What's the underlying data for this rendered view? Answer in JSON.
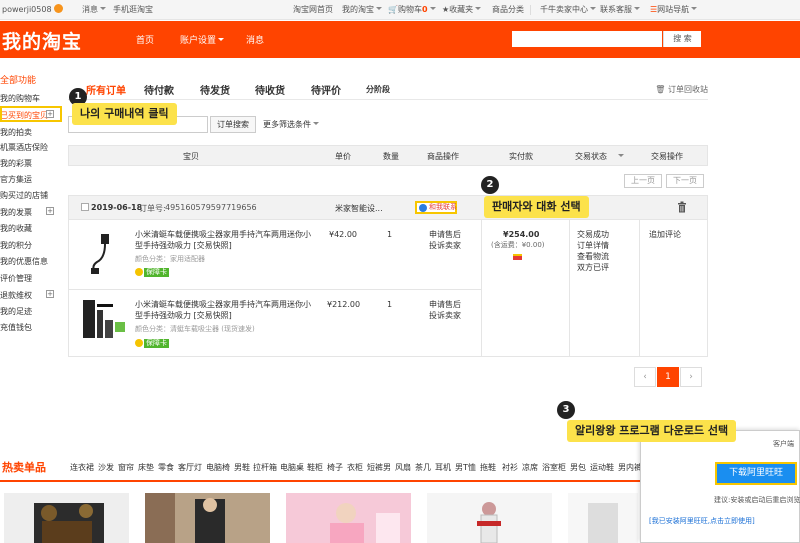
{
  "topbar": {
    "username": "powerji0508",
    "messages": "消息",
    "mobile": "手机逛淘宝",
    "home": "淘宝网首页",
    "my_taobao": "我的淘宝",
    "cart": "购物车",
    "cart_count": "0",
    "favorites": "收藏夹",
    "categories": "商品分类",
    "seller_center": "千牛卖家中心",
    "service": "联系客服",
    "site_nav": "网站导航"
  },
  "header": {
    "logo": "我的淘宝",
    "nav": [
      "首页",
      "账户设置",
      "消息"
    ],
    "search_button": "搜 索"
  },
  "sidebar": {
    "title": "全部功能",
    "items": [
      "我的购物车",
      "已买到的宝贝",
      "我的拍卖",
      "机票酒店保险",
      "我的彩票",
      "官方集运",
      "购买过的店铺",
      "我的发票",
      "我的收藏",
      "我的积分",
      "我的优惠信息",
      "评价管理",
      "退款维权",
      "我的足迹",
      "充值钱包"
    ]
  },
  "tabs": {
    "items": [
      "所有订单",
      "待付款",
      "待发货",
      "待收货",
      "待评价",
      "分阶段"
    ],
    "recycle": "订单回收站"
  },
  "search": {
    "button": "订单搜索",
    "more": "更多筛选条件"
  },
  "table_header": [
    "宝贝",
    "单价",
    "数量",
    "商品操作",
    "实付款",
    "交易状态",
    "交易操作"
  ],
  "pager_top": {
    "prev": "上一页",
    "next": "下一页"
  },
  "order": {
    "date": "2019-06-18",
    "order_no_label": "订单号:",
    "order_no": "495160579597719656",
    "shop": "米家智能设...",
    "chat": "和我联系",
    "items": [
      {
        "title": "小米清蜓车载便携吸尘器家用手持汽车两用迷你小型手持强劲吸力 [交易快照]",
        "spec": "颜色分类：家用适配器",
        "badge": "保障卡",
        "price": "¥42.00",
        "qty": "1",
        "actions": [
          "申请售后",
          "投诉卖家"
        ]
      },
      {
        "title": "小米清蜓车载便携吸尘器家用手持汽车两用迷你小型手持强劲吸力 [交易快照]",
        "spec": "颜色分类：清蜓车载吸尘器 (现货速发)",
        "badge": "保障卡",
        "price": "¥212.00",
        "qty": "1",
        "actions": [
          "申请售后",
          "投诉卖家"
        ]
      }
    ],
    "paid": "¥254.00",
    "shipping": "(含运费：¥0.00)",
    "status": [
      "交易成功",
      "订单详情",
      "查看物流",
      "双方已评"
    ],
    "op": "追加评论"
  },
  "pager": {
    "current": "1"
  },
  "hot": {
    "title": "热卖单品",
    "tags": [
      "连衣裙",
      "沙发",
      "窗帘",
      "床垫",
      "零食",
      "客厅灯",
      "电脑椅",
      "男鞋",
      "拉杆箱",
      "电脑桌",
      "鞋柜",
      "椅子",
      "衣柜",
      "短裤男",
      "风扇",
      "茶几",
      "耳机",
      "男T恤",
      "拖鞋",
      "衬衫",
      "凉席",
      "浴室柜",
      "男包",
      "运动鞋",
      "男内裤"
    ]
  },
  "popup": {
    "partial_text": "客户端",
    "download": "下载阿里旺旺",
    "hint": "建议:安装或启动后重启浏览器",
    "link": "[我已安装阿里旺旺,点击立即使用]"
  },
  "callouts": [
    {
      "num": "1",
      "text": "나의 구매내역 클릭"
    },
    {
      "num": "2",
      "text": "판매자와 대화 선택"
    },
    {
      "num": "3",
      "text": "알리왕왕 프로그램 다운로드 선택"
    }
  ],
  "colors": {
    "brand": "#ff4400",
    "highlight": "#f7c600",
    "callout": "#fce24b",
    "download": "#1a8ef0"
  }
}
